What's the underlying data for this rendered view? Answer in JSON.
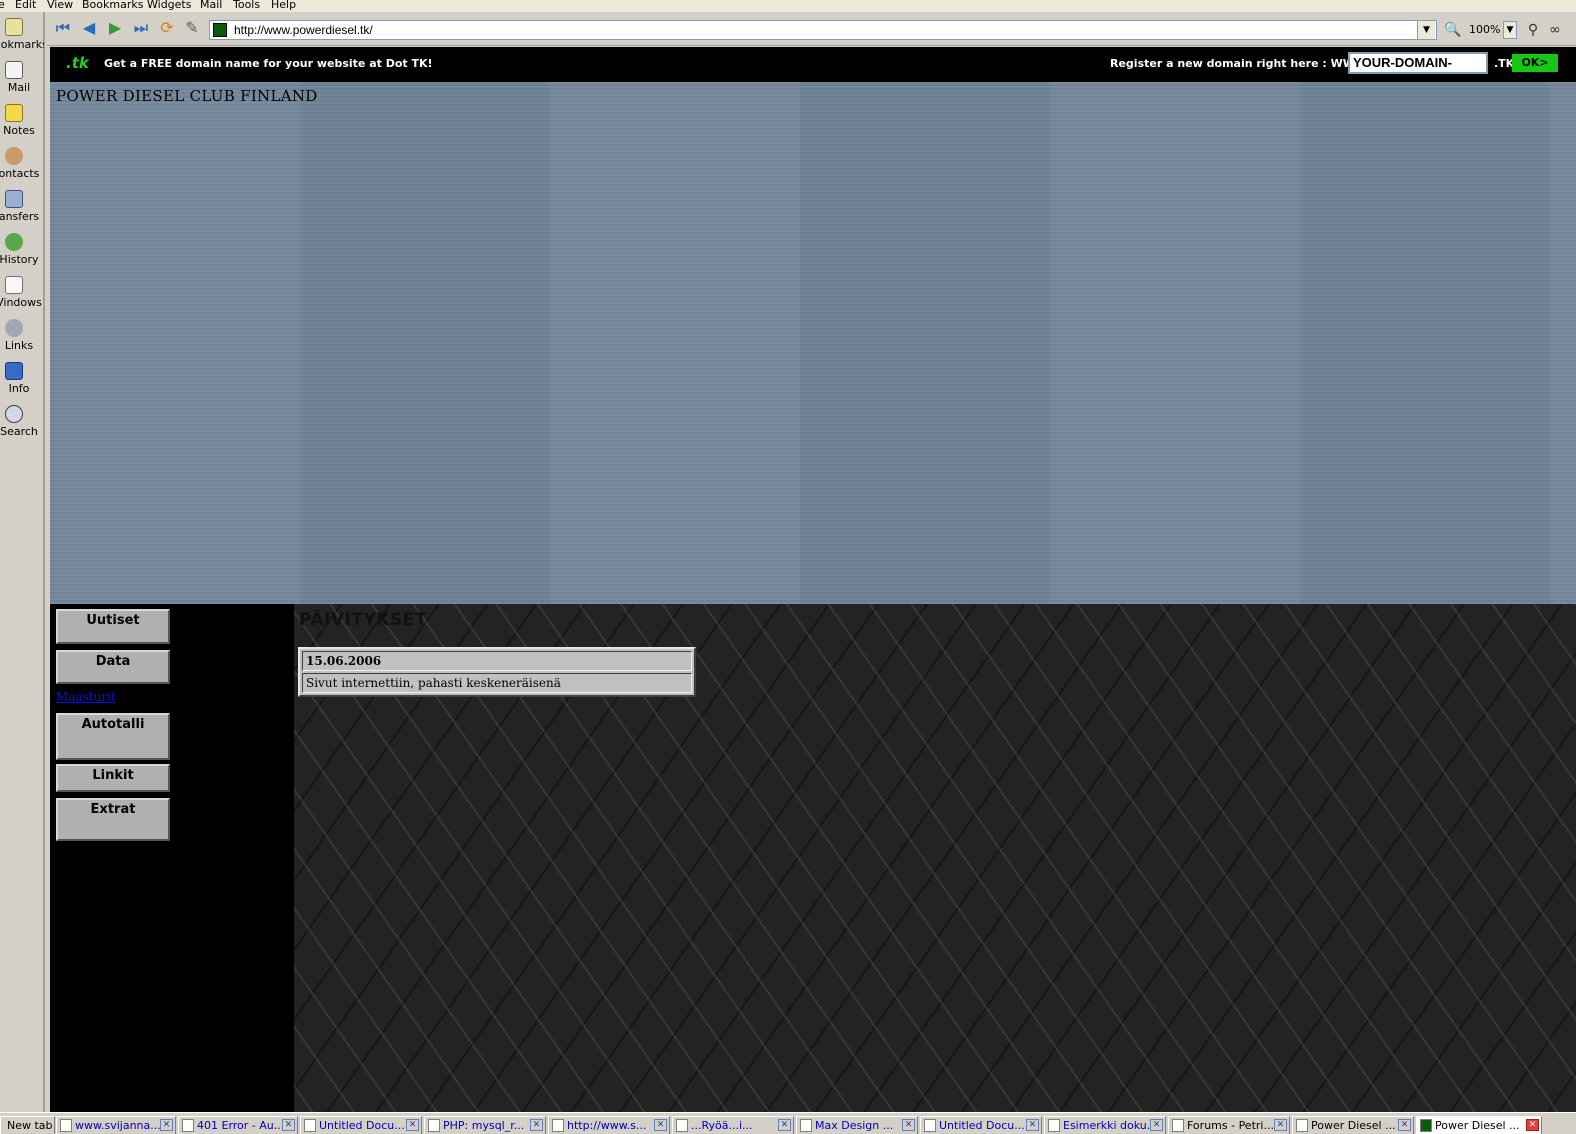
{
  "menu": [
    "e",
    "Edit",
    "View",
    "Bookmarks",
    "Widgets",
    "Mail",
    "Tools",
    "Help"
  ],
  "panel": [
    {
      "label": "ookmarks",
      "icon": "bookmarks-icon"
    },
    {
      "label": "Mail",
      "icon": "mail-icon"
    },
    {
      "label": "Notes",
      "icon": "notes-icon"
    },
    {
      "label": "ontacts",
      "icon": "contacts-icon"
    },
    {
      "label": "ansfers",
      "icon": "transfers-icon"
    },
    {
      "label": "History",
      "icon": "history-icon"
    },
    {
      "label": "Vindows",
      "icon": "windows-icon"
    },
    {
      "label": "Links",
      "icon": "links-icon"
    },
    {
      "label": "Info",
      "icon": "info-icon"
    },
    {
      "label": "Search",
      "icon": "search-icon"
    }
  ],
  "toolbar": {
    "back": "◀",
    "forward": "▶",
    "url": "http://www.powerdiesel.tk/",
    "zoom": "100%"
  },
  "dotbar": {
    "logo": ".tk",
    "promo": "Get a FREE domain name for your website at Dot TK!",
    "register": "Register a new domain right here : WWW.",
    "input_value": "YOUR-DOMAIN-NAME",
    "tld": ".TK",
    "ok": "OK>"
  },
  "site": {
    "title": "POWER DIESEL CLUB FINLAND",
    "nav": {
      "uutiset": "Uutiset",
      "data": "Data",
      "link": "Maasturit",
      "autotalli": "Autotalli",
      "linkit": "Linkit",
      "extrat": "Extrat"
    },
    "section_title": "PÄIVITYKSET",
    "news": {
      "date": "15.06.2006",
      "text": "Sivut internettiin, pahasti keskeneräisenä"
    }
  },
  "tabs": [
    "New tab",
    "www.svijanna...",
    "401 Error - Au...",
    "Untitled Docu...",
    "PHP: mysql_r...",
    "http://www.s...",
    "...Ryöä...i...",
    "Max Design ...",
    "Untitled Docu...",
    "Esimerkki doku...",
    "Forums - Petri...",
    "Power Diesel ...",
    "Power Diesel ..."
  ]
}
